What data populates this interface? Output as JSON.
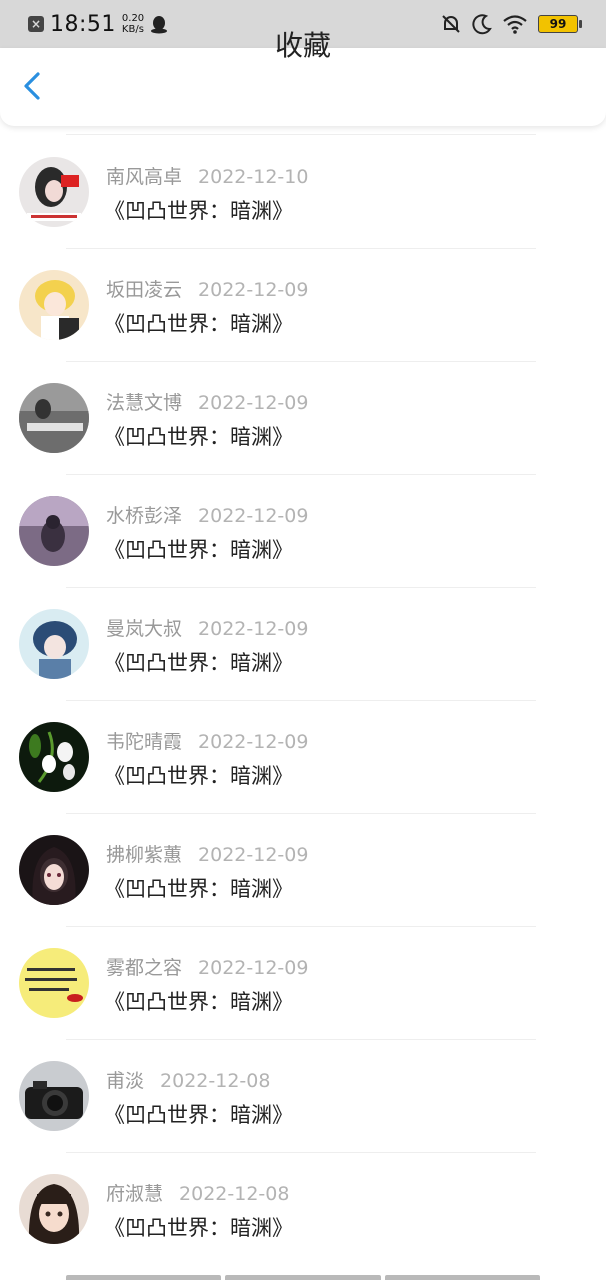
{
  "status_bar": {
    "time": "18:51",
    "speed_value": "0.20",
    "speed_unit": "KB/s",
    "battery": "99"
  },
  "header": {
    "title": "收藏"
  },
  "items": [
    {
      "name": "南风高卓",
      "date": "2022-12-10",
      "book": "《凹凸世界：暗渊》"
    },
    {
      "name": "坂田凌云",
      "date": "2022-12-09",
      "book": "《凹凸世界：暗渊》"
    },
    {
      "name": "法慧文博",
      "date": "2022-12-09",
      "book": "《凹凸世界：暗渊》"
    },
    {
      "name": "水桥彭泽",
      "date": "2022-12-09",
      "book": "《凹凸世界：暗渊》"
    },
    {
      "name": "曼岚大叔",
      "date": "2022-12-09",
      "book": "《凹凸世界：暗渊》"
    },
    {
      "name": "韦陀晴霞",
      "date": "2022-12-09",
      "book": "《凹凸世界：暗渊》"
    },
    {
      "name": "拂柳紫蕙",
      "date": "2022-12-09",
      "book": "《凹凸世界：暗渊》"
    },
    {
      "name": "雾都之容",
      "date": "2022-12-09",
      "book": "《凹凸世界：暗渊》"
    },
    {
      "name": "甫淡",
      "date": "2022-12-08",
      "book": "《凹凸世界：暗渊》"
    },
    {
      "name": "府淑慧",
      "date": "2022-12-08",
      "book": "《凹凸世界：暗渊》"
    }
  ],
  "colors": {
    "accent": "#2a8fe0",
    "status_bar_bg": "#d8d8d8",
    "battery": "#f2c200"
  }
}
